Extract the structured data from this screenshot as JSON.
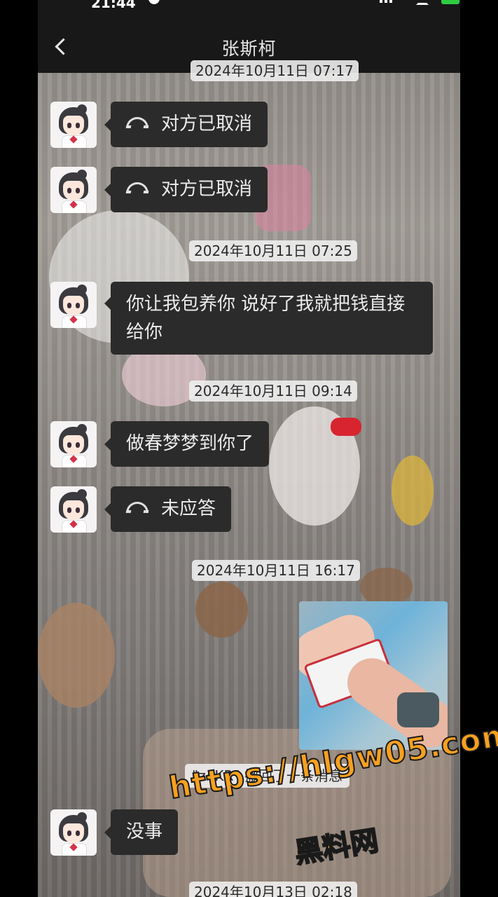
{
  "status": {
    "time": "21:44"
  },
  "header": {
    "title": "张斯柯",
    "back": "返回"
  },
  "messages": [
    {
      "type": "call",
      "text": "对方已取消"
    },
    {
      "type": "call",
      "text": "对方已取消"
    },
    {
      "type": "timestamp",
      "text": "2024年10月11日 07:25"
    },
    {
      "type": "text",
      "text": "你让我包养你 说好了我就把钱直接给你"
    },
    {
      "type": "timestamp",
      "text": "2024年10月11日 09:14"
    },
    {
      "type": "text",
      "text": "做春梦梦到你了"
    },
    {
      "type": "call",
      "text": "未应答"
    },
    {
      "type": "timestamp",
      "text": "2024年10月11日 16:17"
    },
    {
      "type": "image"
    },
    {
      "type": "notice",
      "text": "\"z4KR\" 撤回了一条消息"
    },
    {
      "type": "text",
      "text": "没事"
    },
    {
      "type": "timestamp",
      "text": "2024年10月13日 02:18"
    }
  ],
  "top_timestamp": "2024年10月11日 07:17",
  "watermark": {
    "url": "https://hlgw05.com",
    "name": "黑料网"
  },
  "colors": {
    "bubble": "#2b2b2b",
    "header": "#181818",
    "watermark": "#f7a020"
  }
}
